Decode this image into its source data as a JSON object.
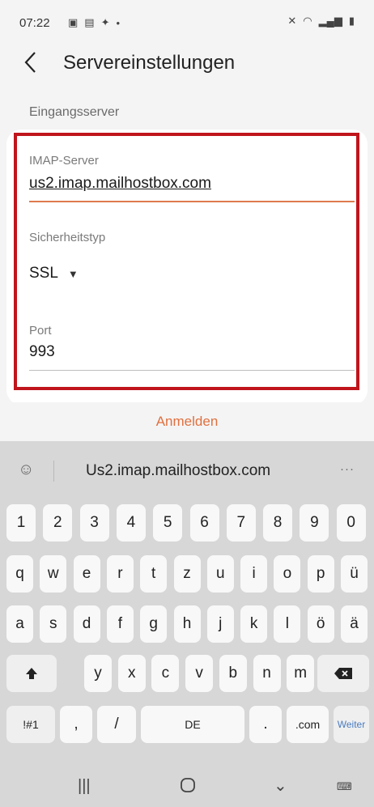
{
  "status": {
    "time": "07:22",
    "left_icons": [
      "image-icon",
      "card-icon",
      "twitter-icon",
      "dot-icon"
    ],
    "right_icons": [
      "mute-icon",
      "wifi-icon",
      "signal-icon",
      "signal-icon",
      "battery-icon"
    ]
  },
  "header": {
    "title": "Servereinstellungen",
    "back_icon": "back-arrow-icon"
  },
  "section": {
    "label": "Eingangsserver"
  },
  "form": {
    "imap_label": "IMAP-Server",
    "imap_value": "us2.imap.mailhostbox.com",
    "security_label": "Sicherheitstyp",
    "security_value": "SSL",
    "port_label": "Port",
    "port_value": "993"
  },
  "actions": {
    "login_label": "Anmelden"
  },
  "keyboard": {
    "suggestion": "Us2.imap.mailhostbox.com",
    "suggest_more": "···",
    "row_numbers": [
      "1",
      "2",
      "3",
      "4",
      "5",
      "6",
      "7",
      "8",
      "9",
      "0"
    ],
    "row1": [
      "q",
      "w",
      "e",
      "r",
      "t",
      "z",
      "u",
      "i",
      "o",
      "p",
      "ü"
    ],
    "row2": [
      "a",
      "s",
      "d",
      "f",
      "g",
      "h",
      "j",
      "k",
      "l",
      "ö",
      "ä"
    ],
    "row3": [
      "y",
      "x",
      "c",
      "v",
      "b",
      "n",
      "m"
    ],
    "symbols_label": "!#1",
    "comma": ",",
    "slash": "/",
    "space_label": "DE",
    "dot": ".",
    "com_label": ".com",
    "go_label": "Weiter"
  },
  "colors": {
    "accent": "#e0703f",
    "highlight": "#c0151c",
    "keyboard_bg": "#d7d7d7"
  }
}
